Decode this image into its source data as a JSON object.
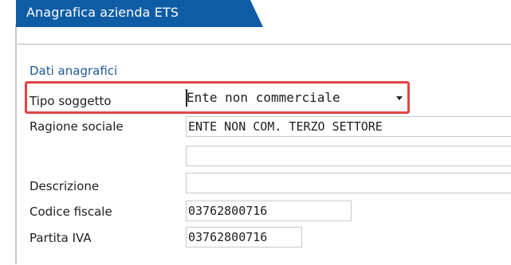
{
  "window": {
    "title": "Anagrafica azienda ETS"
  },
  "section": {
    "title": "Dati anagrafici"
  },
  "fields": {
    "tipo_soggetto": {
      "label": "Tipo soggetto",
      "value": "Ente non commerciale"
    },
    "ragione_sociale": {
      "label": "Ragione sociale",
      "value": "ENTE NON COM. TERZO SETTORE",
      "value2": ""
    },
    "descrizione": {
      "label": "Descrizione",
      "value": ""
    },
    "codice_fiscale": {
      "label": "Codice fiscale",
      "value": "03762800716"
    },
    "partita_iva": {
      "label": "Partita IVA",
      "value": "03762800716"
    }
  },
  "colors": {
    "title_bar": "#0d5ca4",
    "section_title": "#1e5a92",
    "highlight_border": "#e04444"
  },
  "icons": {
    "combo_arrow": "chevron-down-icon"
  }
}
